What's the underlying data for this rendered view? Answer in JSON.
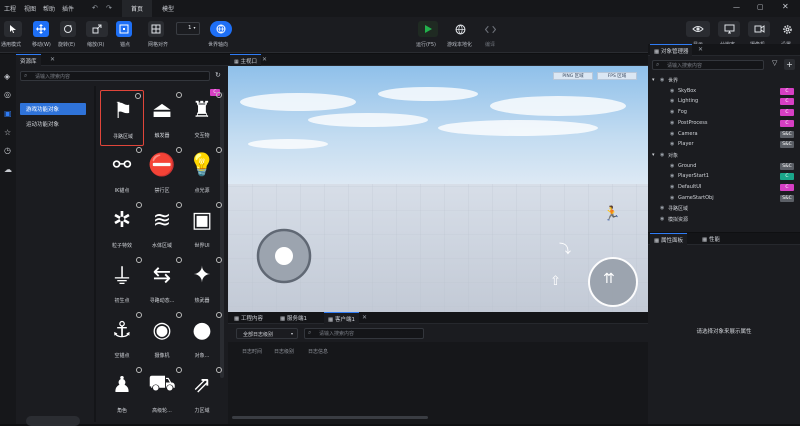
{
  "menubar": {
    "items": [
      "工程",
      "视图",
      "帮助",
      "插件"
    ],
    "tabs": [
      "首页",
      "模型"
    ]
  },
  "toolbar": {
    "left": [
      {
        "label": "通用模式",
        "icon": "cursor-icon"
      },
      {
        "label": "移动(W)",
        "icon": "move-icon"
      },
      {
        "label": "旋转(E)",
        "icon": "rotate-icon"
      },
      {
        "label": "缩放(R)",
        "icon": "scale-icon"
      },
      {
        "label": "锚点",
        "icon": "anchor-point-icon"
      },
      {
        "label": "网格对齐",
        "icon": "grid-snap-icon"
      },
      {
        "label": "世界轴向",
        "icon": "world-axis-icon"
      }
    ],
    "grid_value": "1",
    "center": [
      {
        "label": "运行(F5)",
        "icon": "play-icon"
      },
      {
        "label": "游戏本地化",
        "icon": "globe-icon"
      },
      {
        "label": "编译",
        "icon": "code-icon"
      }
    ],
    "right": [
      {
        "label": "显示",
        "icon": "eye-icon"
      },
      {
        "label": "分辨率",
        "icon": "monitor-icon"
      },
      {
        "label": "摄像机",
        "icon": "camera-icon"
      },
      {
        "label": "设置",
        "icon": "gear-icon"
      }
    ],
    "accent": "#1e6ff5",
    "play_color": "#22b14c"
  },
  "assets": {
    "tab": "资源库",
    "search_placeholder": "请输入搜索内容",
    "categories": [
      "游戏功能对象",
      "运动功能对象"
    ],
    "items": [
      {
        "label": "寻路区域",
        "icon": "signpost-icon"
      },
      {
        "label": "触发器",
        "icon": "trigger-icon"
      },
      {
        "label": "交互物",
        "icon": "chair-icon"
      },
      {
        "label": "IK锚点",
        "icon": "ik-anchor-icon"
      },
      {
        "label": "禁行区",
        "icon": "no-entry-icon"
      },
      {
        "label": "点光源",
        "icon": "light-bulb-icon"
      },
      {
        "label": "粒子特效",
        "icon": "particle-icon"
      },
      {
        "label": "水体区域",
        "icon": "water-icon"
      },
      {
        "label": "世界UI",
        "icon": "world-ui-icon"
      },
      {
        "label": "初生点",
        "icon": "spawn-point-icon"
      },
      {
        "label": "寻路动态...",
        "icon": "nav-dynamic-icon"
      },
      {
        "label": "热武器",
        "icon": "gun-icon"
      },
      {
        "label": "空锚点",
        "icon": "anchor-icon"
      },
      {
        "label": "摄像机",
        "icon": "camera-icon"
      },
      {
        "label": "对象...",
        "icon": "object-icon"
      },
      {
        "label": "角色",
        "icon": "character-icon"
      },
      {
        "label": "高级轮...",
        "icon": "truck-icon"
      },
      {
        "label": "力区域",
        "icon": "force-area-icon"
      }
    ]
  },
  "viewport": {
    "tab": "主视口",
    "badges": [
      "PING 区域",
      "FPS 区域"
    ]
  },
  "console": {
    "tabs": [
      "工程内容",
      "服务端1",
      "客户端1"
    ],
    "filter": "全部日志级别",
    "search_placeholder": "请输入搜索内容",
    "columns": [
      "日志时间",
      "日志级别",
      "日志信息"
    ]
  },
  "outline": {
    "tab": "对象管理器",
    "search_placeholder": "请输入搜索内容",
    "world": "世界",
    "world_items": [
      {
        "name": "SkyBox",
        "badge": "C",
        "color": "#d63fc4"
      },
      {
        "name": "Lighting",
        "badge": "C",
        "color": "#d63fc4"
      },
      {
        "name": "Fog",
        "badge": "C",
        "color": "#d63fc4"
      },
      {
        "name": "PostProcess",
        "badge": "C",
        "color": "#d63fc4"
      },
      {
        "name": "Camera",
        "badge": "S&C",
        "color": "#5b5f66"
      },
      {
        "name": "Player",
        "badge": "S&C",
        "color": "#5b5f66"
      }
    ],
    "objects": "对象",
    "object_items": [
      {
        "name": "Ground",
        "badge": "S&C",
        "color": "#5b5f66"
      },
      {
        "name": "PlayerStart1",
        "badge": "C",
        "color": "#1aa68a"
      },
      {
        "name": "DefaultUI",
        "badge": "C",
        "color": "#d63fc4"
      },
      {
        "name": "GameStartObj",
        "badge": "S&C",
        "color": "#5b5f66"
      }
    ],
    "extra": [
      "寻路区域",
      "模拟资源"
    ]
  },
  "properties": {
    "tabs": [
      "属性面板",
      "性能"
    ],
    "empty": "请选择对象来展示属性"
  }
}
